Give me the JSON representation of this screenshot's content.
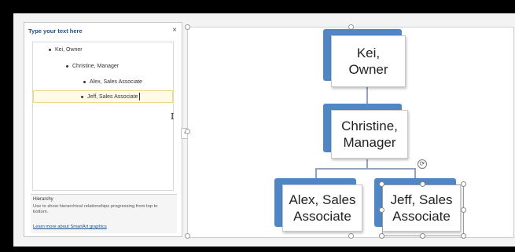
{
  "text_pane": {
    "title": "Type your text here",
    "close": "×",
    "items": [
      {
        "label": "Kei, Owner"
      },
      {
        "label": "Christine, Manager"
      },
      {
        "label": "Alex, Sales Associate"
      },
      {
        "label": "Jeff, Sales Associate"
      }
    ],
    "description": {
      "title": "Hierarchy",
      "body": "Use to show hierarchical relationships progressing from top to bottom.",
      "link": "Learn more about SmartArt graphics"
    },
    "toggle": "‹"
  },
  "smartart": {
    "accent_color": "#4e86c6",
    "shapes": [
      {
        "text": "Kei,\nOwner"
      },
      {
        "text": "Christine,\nManager"
      },
      {
        "text": "Alex, Sales\nAssociate"
      },
      {
        "text": "Jeff, Sales\nAssociate"
      }
    ],
    "rotate_icon": "⟳"
  }
}
